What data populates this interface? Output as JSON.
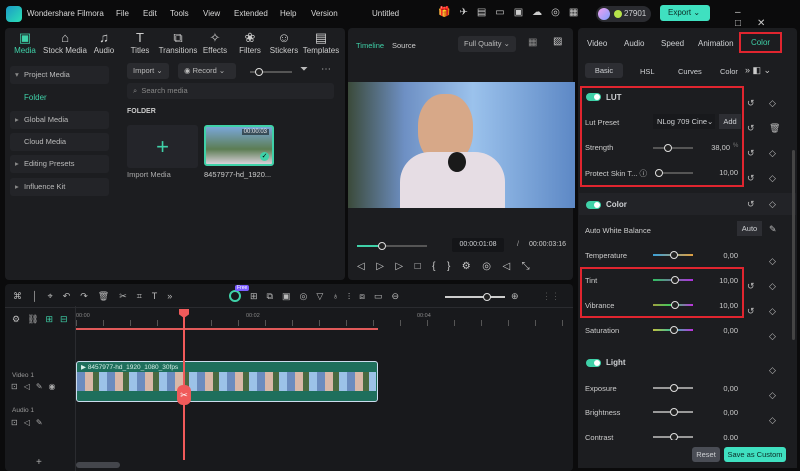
{
  "app": {
    "title": "Wondershare Filmora",
    "project": "Untitled",
    "credits": "27901",
    "export": "Export"
  },
  "menu": [
    "File",
    "Edit",
    "Tools",
    "View",
    "Extended",
    "Help",
    "Version"
  ],
  "toolbar": [
    "Media",
    "Stock Media",
    "Audio",
    "Titles",
    "Transitions",
    "Effects",
    "Filters",
    "Stickers",
    "Templates"
  ],
  "sidebar": [
    "Project Media",
    "Folder",
    "Global Media",
    "Cloud Media",
    "Editing Presets",
    "Influence Kit"
  ],
  "media": {
    "import": "Import",
    "record": "Record",
    "search_placeholder": "Search media",
    "folder": "FOLDER",
    "import_media": "Import Media",
    "clip_name": "8457977-hd_1920...",
    "clip_duration": "00:00:03"
  },
  "preview": {
    "tab_timeline": "Timeline",
    "tab_source": "Source",
    "quality": "Full Quality",
    "current": "00:00:01:08",
    "separator": "/",
    "total": "00:00:03:16",
    "progress": 0.35
  },
  "right": {
    "tabs": [
      "Video",
      "Audio",
      "Speed",
      "Animation",
      "Color"
    ],
    "subtabs": [
      "Basic",
      "HSL",
      "Curves",
      "Color"
    ],
    "lut": {
      "title": "LUT",
      "preset_label": "Lut Preset",
      "preset": "NLog 709 Cine",
      "add": "Add",
      "strength_label": "Strength",
      "strength": "38,00",
      "strength_unit": "%",
      "skin_label": "Protect Skin T...",
      "skin": "10,00"
    },
    "color": {
      "title": "Color",
      "awb": "Auto White Balance",
      "auto": "Auto",
      "temperature_label": "Temperature",
      "temperature": "0,00",
      "tint_label": "Tint",
      "tint": "10,00",
      "vibrance_label": "Vibrance",
      "vibrance": "10,00",
      "saturation_label": "Saturation",
      "saturation": "0,00"
    },
    "light": {
      "title": "Light",
      "exposure_label": "Exposure",
      "exposure": "0,00",
      "brightness_label": "Brightness",
      "brightness": "0,00",
      "contrast_label": "Contrast",
      "contrast": "0,00"
    },
    "reset": "Reset",
    "save_custom": "Save as Custom"
  },
  "timeline": {
    "ticks": [
      "00:00",
      "00:02",
      "00:04"
    ],
    "video_track": "Video 1",
    "audio_track": "Audio 1",
    "clip": "8457977-hd_1920_1080_30fps",
    "new_badge": "Free"
  }
}
